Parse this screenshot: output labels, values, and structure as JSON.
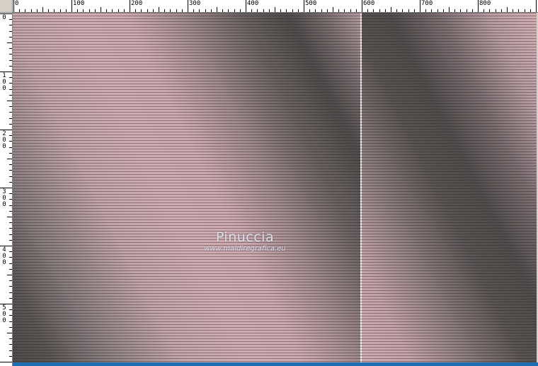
{
  "ruler": {
    "top_labels": [
      "0",
      "100",
      "200",
      "300",
      "400",
      "500",
      "600",
      "700",
      "800"
    ],
    "left_labels": [
      "0",
      "100",
      "200",
      "300",
      "400",
      "500"
    ]
  },
  "watermark": {
    "name": "Pinuccia",
    "url": "www.maidiregrafica.eu"
  },
  "colors": {
    "ruler_bg": "#ffffff",
    "chrome": "#d4d0c8",
    "pink": "#d2aeb4",
    "dark": "#4f4b4b",
    "separator": "#f1eaeb",
    "taskbar_accent": "#1f6fb4"
  }
}
